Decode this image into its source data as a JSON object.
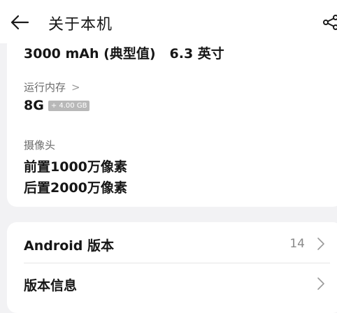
{
  "header": {
    "title": "关于本机",
    "back_icon": "arrow-left-icon",
    "share_icon": "share-icon"
  },
  "specs": {
    "battery_screen": [
      "3000 mAh (典型值)",
      "6.3 英寸"
    ],
    "ram": {
      "label": "运行内存",
      "chevron": ">",
      "value": "8G",
      "badge": "+ 4.00 GB"
    },
    "camera": {
      "label": "摄像头",
      "front": "前置1000万像素",
      "rear": "后置2000万像素"
    }
  },
  "system": {
    "android_label": "Android 版本",
    "android_value": "14",
    "version_info_label": "版本信息"
  },
  "colors": {
    "background": "#f2f2f4",
    "card": "#ffffff",
    "badge": "#b8b8b8"
  }
}
